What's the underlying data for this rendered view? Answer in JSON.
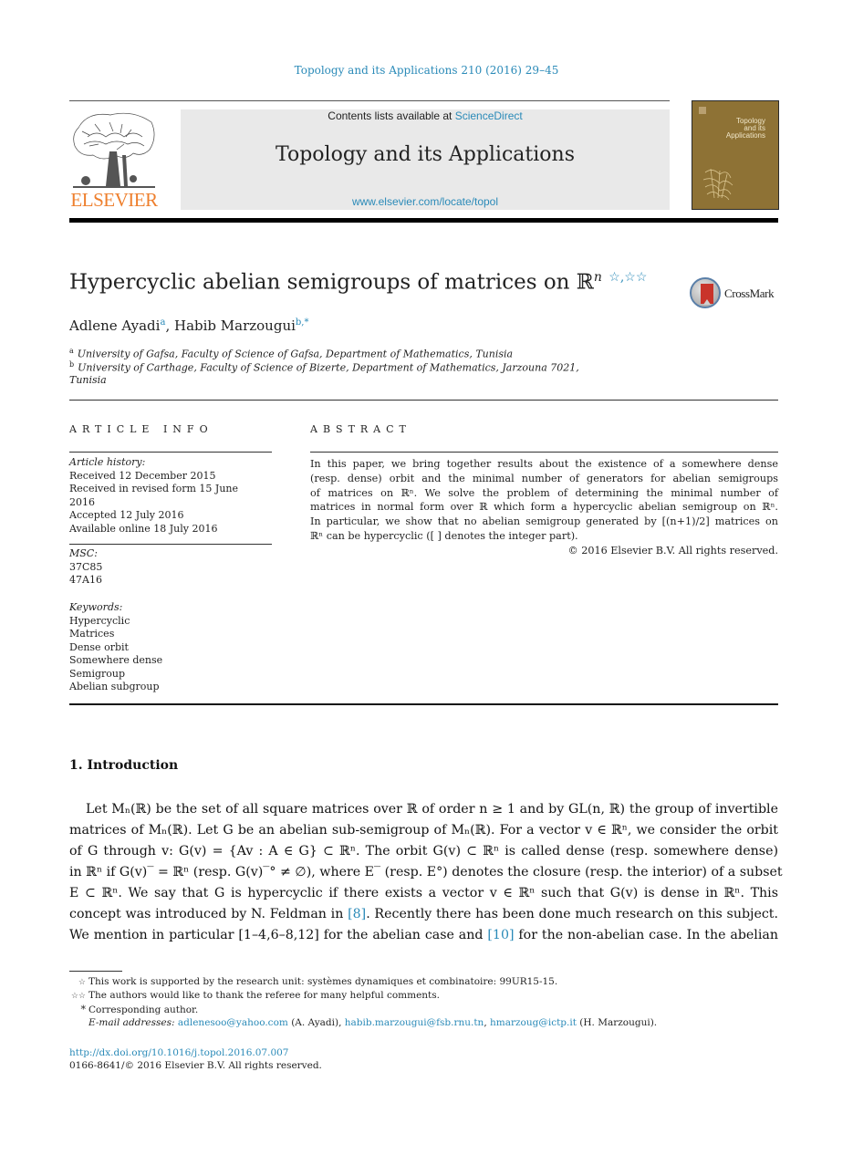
{
  "header": {
    "journal_reference": "Topology and its Applications 210 (2016) 29–45",
    "contents_prefix": "Contents lists available at ",
    "contents_link": "ScienceDirect",
    "journal_title": "Topology and its Applications",
    "journal_url": "www.elsevier.com/locate/topol",
    "publisher_logo_text": "ELSEVIER",
    "cover_title_lines": [
      "Topology",
      "and its",
      "Applications"
    ],
    "colors": {
      "link": "#2a8ab8",
      "elsevier_orange": "#ee7f2d",
      "cover_bg": "#8e7235"
    }
  },
  "article": {
    "title": "Hypercyclic abelian semigroups of matrices on ℝ",
    "title_superscript": "n",
    "title_notes": "☆,☆☆",
    "crossmark_label": "CrossMark",
    "authors": [
      {
        "name": "Adlene Ayadi",
        "sup": "a"
      },
      {
        "name": "Habib Marzougui",
        "sup": "b,*"
      }
    ],
    "affiliations": [
      {
        "sup": "a",
        "text": "University of Gafsa, Faculty of Science of Gafsa, Department of Mathematics, Tunisia"
      },
      {
        "sup": "b",
        "text": "University of Carthage, Faculty of Science of Bizerte, Department of Mathematics, Jarzouna 7021,",
        "text_cont": "Tunisia"
      }
    ]
  },
  "article_info": {
    "heading": "ARTICLE INFO",
    "history_label": "Article history:",
    "history": [
      "Received 12 December 2015",
      "Received in revised form 15 June",
      "2016",
      "Accepted 12 July 2016",
      "Available online 18 July 2016"
    ],
    "msc_label": "MSC:",
    "msc": [
      "37C85",
      "47A16"
    ],
    "keywords_label": "Keywords:",
    "keywords": [
      "Hypercyclic",
      "Matrices",
      "Dense orbit",
      "Somewhere dense",
      "Semigroup",
      "Abelian subgroup"
    ]
  },
  "abstract": {
    "heading": "ABSTRACT",
    "lines": [
      "In this paper, we bring together results about the existence of a somewhere dense",
      "(resp. dense) orbit and the minimal number of generators for abelian semigroups",
      "of matrices on ℝⁿ. We solve the problem of determining the minimal number of",
      "matrices in normal form over ℝ which form a hypercyclic abelian semigroup on ℝⁿ.",
      "In particular, we show that no abelian semigroup generated by [(n+1)/2] matrices on",
      "ℝⁿ can be hypercyclic ([ ] denotes the integer part)."
    ],
    "copyright": "© 2016 Elsevier B.V. All rights reserved."
  },
  "introduction": {
    "heading": "1.  Introduction",
    "lines": [
      "Let Mₙ(ℝ) be the set of all square matrices over ℝ of order n ≥ 1 and by GL(n, ℝ) the group of invertible",
      "matrices of Mₙ(ℝ). Let G be an abelian sub-semigroup of Mₙ(ℝ). For a vector v ∈ ℝⁿ, we consider the orbit",
      "of G through v: G(v) = {Av :  A ∈ G} ⊂ ℝⁿ. The orbit G(v) ⊂ ℝⁿ is called dense (resp. somewhere dense)",
      "in ℝⁿ if G(v)‾ = ℝⁿ (resp. G(v)‾° ≠ ∅), where E‾ (resp. E°) denotes the closure (resp. the interior) of a subset",
      "E ⊂ ℝⁿ. We say that G is hypercyclic if there exists a vector v ∈ ℝⁿ such that G(v) is dense in ℝⁿ. This",
      "concept was introduced by N. Feldman in [8]. Recently there has been done much research on this subject.",
      "We mention in particular [1–4,6–8,12] for the abelian case and [10] for the non-abelian case. In the abelian"
    ],
    "citations": [
      "[8]",
      "[1–4,6–8,12]",
      "[10]"
    ]
  },
  "footnotes": [
    {
      "mark": "☆",
      "text": "This work is supported by the research unit: systèmes dynamiques et combinatoire: 99UR15-15."
    },
    {
      "mark": "☆☆",
      "text": "The authors would like to thank the referee for many helpful comments."
    },
    {
      "mark": "*",
      "text": "Corresponding author."
    }
  ],
  "emails": {
    "label": "E-mail addresses:",
    "items": [
      {
        "email": "adlenesoo@yahoo.com",
        "owner": " (A. Ayadi), "
      },
      {
        "email": "habib.marzougui@fsb.rnu.tn",
        "owner": ", "
      },
      {
        "email": "hmarzoug@ictp.it",
        "owner": " (H. Marzougui)."
      }
    ]
  },
  "doi": "http://dx.doi.org/10.1016/j.topol.2016.07.007",
  "issn_line": "0166-8641/© 2016 Elsevier B.V. All rights reserved."
}
